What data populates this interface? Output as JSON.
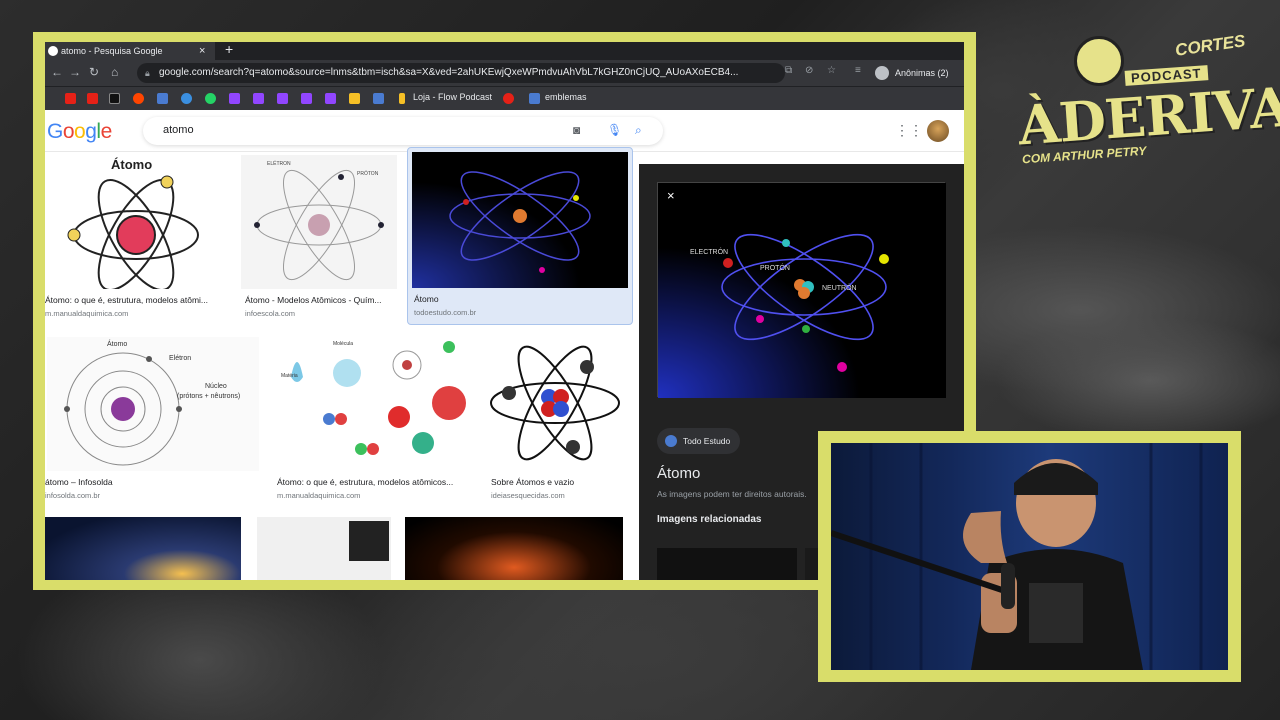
{
  "browser": {
    "tab_title": "atomo - Pesquisa Google",
    "tab_close": "×",
    "new_tab": "+",
    "url": "google.com/search?q=atomo&source=lnms&tbm=isch&sa=X&ved=2ahUKEwjQxeWPmdvuAhVbL7kGHZ0nCjUQ_AUoAXoECB4...",
    "profile_label": "Anônimas (2)",
    "bookmarks": [
      "Loja - Flow Podcast",
      "emblemas"
    ]
  },
  "search": {
    "logo": "Google",
    "query": "atomo"
  },
  "results": [
    {
      "caption": "Átomo: o que é, estrutura, modelos atômi...",
      "source": "m.manualdaquimica.com",
      "thumb_title": "Átomo"
    },
    {
      "caption": "Átomo - Modelos Atômicos - Quím...",
      "source": "infoescola.com"
    },
    {
      "caption": "Átomo",
      "source": "todoestudo.com.br"
    },
    {
      "caption": "átomo – Infosolda",
      "source": "infosolda.com.br"
    },
    {
      "caption": "Átomo: o que é, estrutura, modelos atômicos...",
      "source": "m.manualdaquimica.com"
    },
    {
      "caption": "Sobre Átomos e vazio",
      "source": "ideiasesquecidas.com"
    }
  ],
  "thumb_labels": {
    "electron": "ELÉTRON",
    "proton": "PRÓTON",
    "atomo": "Átomo",
    "eletron2": "Elétron",
    "nucleo": "Núcleo",
    "nucleo_sub": "(prótons + nêutrons)",
    "molecula": "Molécula",
    "materia": "Matéria"
  },
  "side_panel": {
    "close": "×",
    "source_chip": "Todo Estudo",
    "title": "Átomo",
    "rights": "As imagens podem ter direitos autorais.",
    "related": "Imagens relacionadas",
    "preview_labels": {
      "electron": "ELECTRÓN",
      "proton": "PROTÓN",
      "neutron": "NEUTRÓN"
    }
  },
  "logo": {
    "cortes": "CORTES",
    "podcast": "PODCAST",
    "main": "ÀDERIVA",
    "sub": "COM ARTHUR PETRY"
  },
  "colors": {
    "frame": "#d9dd6a",
    "browser_dark": "#202124",
    "side_bg": "#222222"
  }
}
